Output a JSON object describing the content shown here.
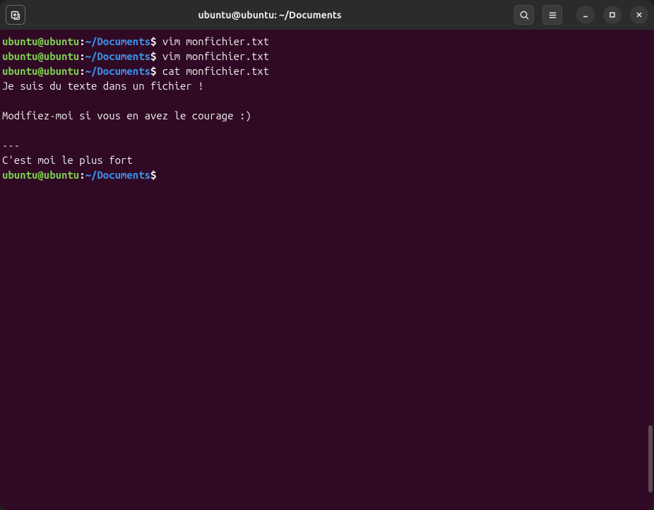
{
  "window": {
    "title": "ubuntu@ubuntu: ~/Documents"
  },
  "prompt": {
    "user_host": "ubuntu@ubuntu",
    "colon": ":",
    "path": "~/Documents",
    "symbol": "$"
  },
  "lines": [
    {
      "type": "cmd",
      "command": " vim monfichier.txt"
    },
    {
      "type": "cmd",
      "command": " vim monfichier.txt"
    },
    {
      "type": "cmd",
      "command": " cat monfichier.txt"
    },
    {
      "type": "out",
      "text": "Je suis du texte dans un fichier !"
    },
    {
      "type": "out",
      "text": ""
    },
    {
      "type": "out",
      "text": "Modifiez-moi si vous en avez le courage :)"
    },
    {
      "type": "out",
      "text": ""
    },
    {
      "type": "out",
      "text": "---"
    },
    {
      "type": "out",
      "text": "C'est moi le plus fort"
    },
    {
      "type": "cmd",
      "command": " "
    }
  ]
}
